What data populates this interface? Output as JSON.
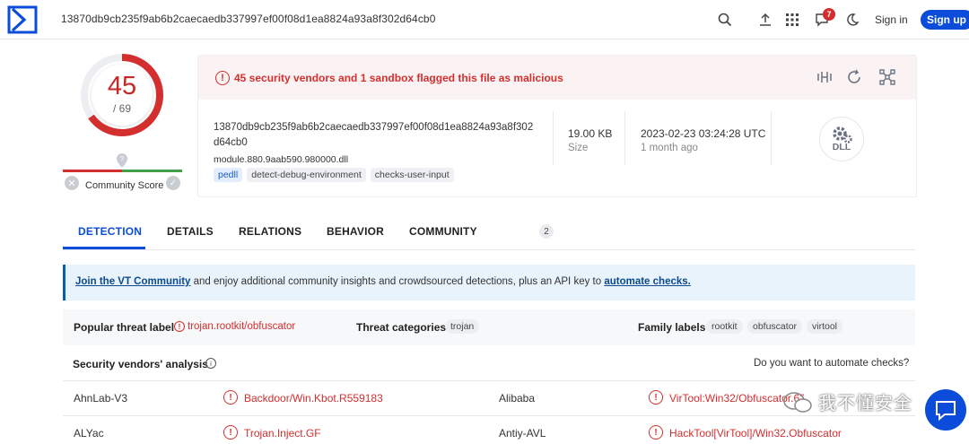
{
  "topbar": {
    "search_value": "13870db9cb235f9ab6b2caecaedb337997ef00f08d1ea8824a93a8f302d64cb0",
    "notification_count": "7",
    "signin_label": "Sign in",
    "signup_label": "Sign up"
  },
  "score": {
    "detections": "45",
    "total": "/ 69",
    "community_label": "Community Score"
  },
  "summary": {
    "alert": "45 security vendors and 1 sandbox flagged this file as malicious",
    "hash": "13870db9cb235f9ab6b2caecaedb337997ef00f08d1ea8824a93a8f302d64cb0",
    "filename": "module.880.9aab590.980000.dll",
    "tags": [
      "pedll",
      "detect-debug-environment",
      "checks-user-input"
    ],
    "size_value": "19.00 KB",
    "size_label": "Size",
    "date_value": "2023-02-23 03:24:28 UTC",
    "date_label": "1 month ago",
    "filetype": "DLL"
  },
  "tabs": {
    "detection": "DETECTION",
    "details": "DETAILS",
    "relations": "RELATIONS",
    "behavior": "BEHAVIOR",
    "community": "COMMUNITY",
    "community_count": "2"
  },
  "join": {
    "link1": "Join the VT Community",
    "middle": " and enjoy additional community insights and crowdsourced detections, plus an API key to ",
    "link2": "automate checks."
  },
  "threat": {
    "popular_label": "Popular threat label",
    "popular_value": "trojan.rootkit/obfuscator",
    "categories_label": "Threat categories",
    "categories": [
      "trojan"
    ],
    "family_label": "Family labels",
    "families": [
      "rootkit",
      "obfuscator",
      "virtool"
    ]
  },
  "vendors": {
    "title": "Security vendors' analysis",
    "automate_question": "Do you want to automate checks?",
    "rows": [
      {
        "left_vendor": "AhnLab-V3",
        "left_result": "Backdoor/Win.Kbot.R559183",
        "right_vendor": "Alibaba",
        "right_result": "VirTool:Win32/Obfuscator.62f6c6"
      },
      {
        "left_vendor": "ALYac",
        "left_result": "Trojan.Inject.GF",
        "right_vendor": "Antiy-AVL",
        "right_result": "HackTool[VirTool]/Win32.Obfuscator"
      }
    ]
  },
  "watermark": "我不懂安全",
  "colors": {
    "brand": "#0b4dda",
    "malicious": "#d32f2f",
    "ok": "#43a047"
  }
}
